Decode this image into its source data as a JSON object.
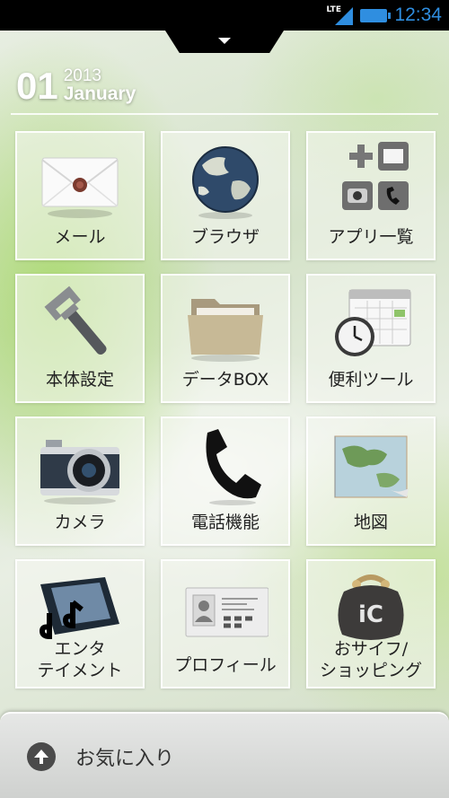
{
  "status_bar": {
    "network": "LTE",
    "time": "12:34"
  },
  "date": {
    "day": "01",
    "year": "2013",
    "month": "January"
  },
  "tiles": [
    {
      "label": "メール",
      "icon": "mail-envelope-icon"
    },
    {
      "label": "ブラウザ",
      "icon": "globe-icon"
    },
    {
      "label": "アプリ一覧",
      "icon": "app-list-icon"
    },
    {
      "label": "本体設定",
      "icon": "wrench-icon"
    },
    {
      "label": "データBOX",
      "icon": "folder-icon"
    },
    {
      "label": "便利ツール",
      "icon": "clock-calendar-icon"
    },
    {
      "label": "カメラ",
      "icon": "camera-icon"
    },
    {
      "label": "電話機能",
      "icon": "phone-handset-icon"
    },
    {
      "label": "地図",
      "icon": "map-icon"
    },
    {
      "label_line1": "エンタ",
      "label_line2": "テイメント",
      "icon": "music-film-icon"
    },
    {
      "label": "プロフィール",
      "icon": "profile-card-icon"
    },
    {
      "label_line1": "おサイフ/",
      "label_line2": "ショッピング",
      "icon": "purse-icon"
    }
  ],
  "purse_badge": "iC",
  "favorites": {
    "label": "お気に入り",
    "icon": "up-arrow-circle-icon"
  }
}
